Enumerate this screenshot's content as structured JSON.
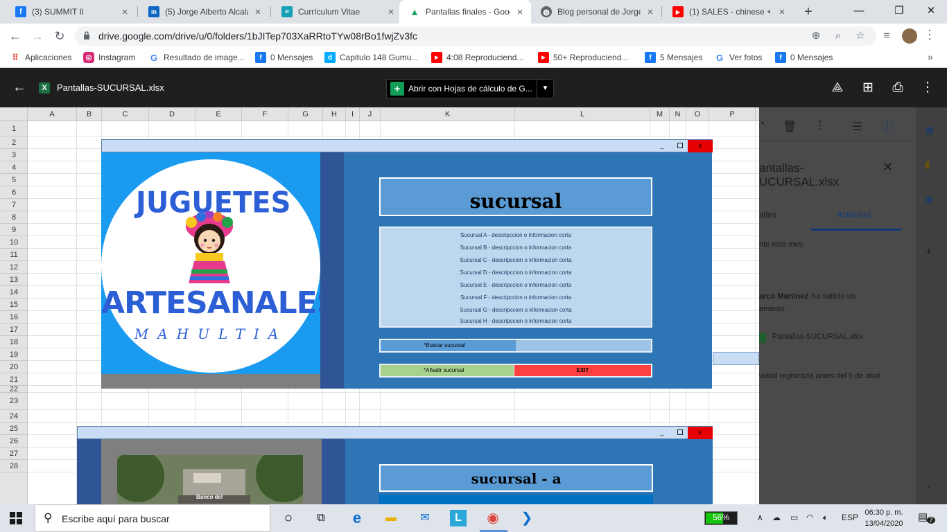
{
  "browser": {
    "tabs": [
      {
        "title": "(3) SUMMIT II",
        "icon": "facebook-icon",
        "color": "#1877f2",
        "glyph": "f"
      },
      {
        "title": "(5) Jorge Alberto Alcalá",
        "icon": "linkedin-icon",
        "color": "#0a66c2",
        "glyph": "in"
      },
      {
        "title": "Currículum Vitae",
        "icon": "resume-icon",
        "color": "#15a0b5",
        "glyph": "≡"
      },
      {
        "title": "Pantallas finales - Goog",
        "icon": "google-drive-icon",
        "color": "#1fa463",
        "glyph": "▲"
      },
      {
        "title": "Blog personal de Jorge",
        "icon": "globe-icon",
        "color": "#5f6368",
        "glyph": "◍"
      },
      {
        "title": "(1) SALES - chinese",
        "icon": "youtube-icon",
        "color": "#ff0000",
        "glyph": "▶"
      }
    ],
    "active_tab": 3,
    "url": "drive.google.com/drive/u/0/folders/1bJITep703XaRRtoTYw08rBo1fwjZv3fc",
    "bookmarks": [
      {
        "label": "Aplicaciones",
        "icon": "apps-grid-icon",
        "color": "#e44134",
        "glyph": "⋮⋮"
      },
      {
        "label": "Instagram",
        "icon": "instagram-icon",
        "color": "#d62976",
        "glyph": "◎"
      },
      {
        "label": "Resultado de image...",
        "icon": "google-icon",
        "color": "#4285f4",
        "glyph": "G"
      },
      {
        "label": "0 Mensajes",
        "icon": "facebook-icon",
        "color": "#1877f2",
        "glyph": "f"
      },
      {
        "label": "Capitulo 148 Gumu...",
        "icon": "dailymotion-icon",
        "color": "#00aaff",
        "glyph": "d"
      },
      {
        "label": "4:08 Reproduciend...",
        "icon": "youtube-icon",
        "color": "#ff0000",
        "glyph": "▶"
      },
      {
        "label": "50+ Reproduciend...",
        "icon": "youtube-icon",
        "color": "#ff0000",
        "glyph": "▶"
      },
      {
        "label": "5 Mensajes",
        "icon": "facebook-icon",
        "color": "#1877f2",
        "glyph": "f"
      },
      {
        "label": "Ver fotos",
        "icon": "google-icon",
        "color": "#4285f4",
        "glyph": "G"
      },
      {
        "label": "0 Mensajes",
        "icon": "facebook-icon",
        "color": "#1877f2",
        "glyph": "f"
      }
    ]
  },
  "viewer": {
    "file_name": "Pantallas-SUCURSAL.xlsx",
    "open_with_label": "Abrir con Hojas de cálculo de G..."
  },
  "sheet": {
    "columns": [
      "A",
      "B",
      "C",
      "D",
      "E",
      "F",
      "G",
      "H",
      "I",
      "J",
      "K",
      "L",
      "M",
      "N",
      "O",
      "P"
    ],
    "rows": [
      "1",
      "2",
      "3",
      "4",
      "5",
      "6",
      "7",
      "8",
      "9",
      "10",
      "11",
      "12",
      "13",
      "14",
      "15",
      "16",
      "17",
      "18",
      "19",
      "20",
      "21",
      "22",
      "23",
      "24",
      "25",
      "26",
      "27",
      "28"
    ]
  },
  "form1": {
    "close_label": "x",
    "min_label": "_",
    "logo_top": "JUGUETES",
    "logo_mid": "ARTESANALES",
    "logo_bottom": "MAHULTIA",
    "title": "sucursal",
    "list_items": [
      "Sucursal A - descripccion o informacion corta",
      "Sucursal B - descripccion o informacion corta",
      "Sucursal C - descripccion o informacion corta",
      "Sucursal D - descripccion o informacion corta",
      "Sucursal E - descripccion o informacion corta",
      "Sucursal F - descripccion o informacion corta",
      "Sucursal G - descripccion o informacion corta",
      "Sucursal H - descripccion o informacion corta"
    ],
    "search_label": "*Buscar sucursal",
    "add_label": "*Añadir sucursal",
    "exit_label": "EXIT"
  },
  "form2": {
    "close_label": "x",
    "min_label": "_",
    "title": "sucursal - a",
    "photo_caption": "Banco del"
  },
  "details_panel": {
    "title_line1": "antallas-",
    "title_line2": "UCURSAL.xlsx",
    "tab_details": "alles",
    "tab_activity": "Actividad",
    "period": "nte este mes",
    "actor": "arco Martinez",
    "action": "ha subido un",
    "action2": "emento",
    "file": "Pantallas-SUCURSAL.xlsx",
    "older": "vidad registrada antes del 5 de abril"
  },
  "taskbar": {
    "search_placeholder": "Escribe aquí para buscar",
    "battery_percent": "56%",
    "battery_level": 0.56,
    "language": "ESP",
    "time": "06:30 p. m.",
    "date": "13/04/2020",
    "notifications": "7"
  }
}
